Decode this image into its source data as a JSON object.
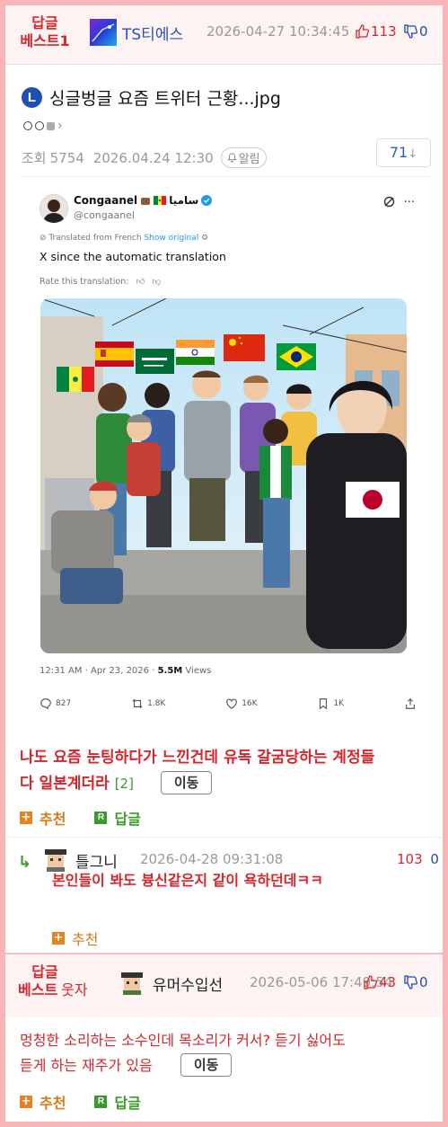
{
  "best_header": {
    "tag_line1": "답글",
    "tag_line2": "베스트1",
    "nickname": "TS티에스",
    "datetime": "2026-04-27 10:34:45",
    "up_count": "113",
    "down_count": "0"
  },
  "post": {
    "badge": "L",
    "title": "싱글벙글 요즘 트위터 근황...jpg",
    "views_label": "조회",
    "views": "5754",
    "date": "2026.04.24 12:30",
    "alarm_label": "알림",
    "comment_count": "71",
    "comment_arrow": "↓"
  },
  "tweet": {
    "display_name": "Congaanel",
    "name_suffix": "ساميا",
    "handle": "@congaanel",
    "translated_prefix": "Translated from French",
    "show_original": "Show original",
    "text": "X since the automatic translation",
    "rate_label": "Rate this translation:",
    "time": "12:31 AM · Apr 23, 2026 · ",
    "views_count": "5.5M",
    "views_label": " Views",
    "actions": {
      "replies": "827",
      "retweets": "1.8K",
      "likes": "16K",
      "bookmarks": "1K"
    }
  },
  "post_body": {
    "line1": "나도 요즘 눈팅하다가 느낀건데 유독 갈굼당하는 계정들",
    "line2": "다 일본계더라",
    "reply_count": "[2]",
    "move_label": "이동",
    "recommend_label": "추천",
    "reply_label": "답글"
  },
  "reply_comment": {
    "arrow": "↳",
    "nickname": "틀그니",
    "datetime": "2026-04-28 09:31:08",
    "up": "103",
    "down": "0",
    "text": "본인들이 봐도 븅신같은지 같이 욕하던데ㅋㅋ",
    "recommend_label": "추천"
  },
  "best_comment2": {
    "tag_line1": "답글",
    "tag_line2": "베스트",
    "tag_suffix": "웃자",
    "nickname": "유머수입선",
    "datetime": "2026-05-06 17:49:54",
    "up_count": "43",
    "down_count": "0",
    "line1": "멍청한 소리하는 소수인데 목소리가 커서? 듣기 싫어도",
    "line2": "듣게 하는 재주가 있음",
    "move_label": "이동",
    "recommend_label": "추천",
    "reply_label": "답글"
  },
  "colors": {
    "accent_red": "#d6252b",
    "link_blue": "#1a4bb8",
    "green": "#3a9a2a",
    "orange": "#e8821e",
    "page_border": "#f7b5b8"
  }
}
